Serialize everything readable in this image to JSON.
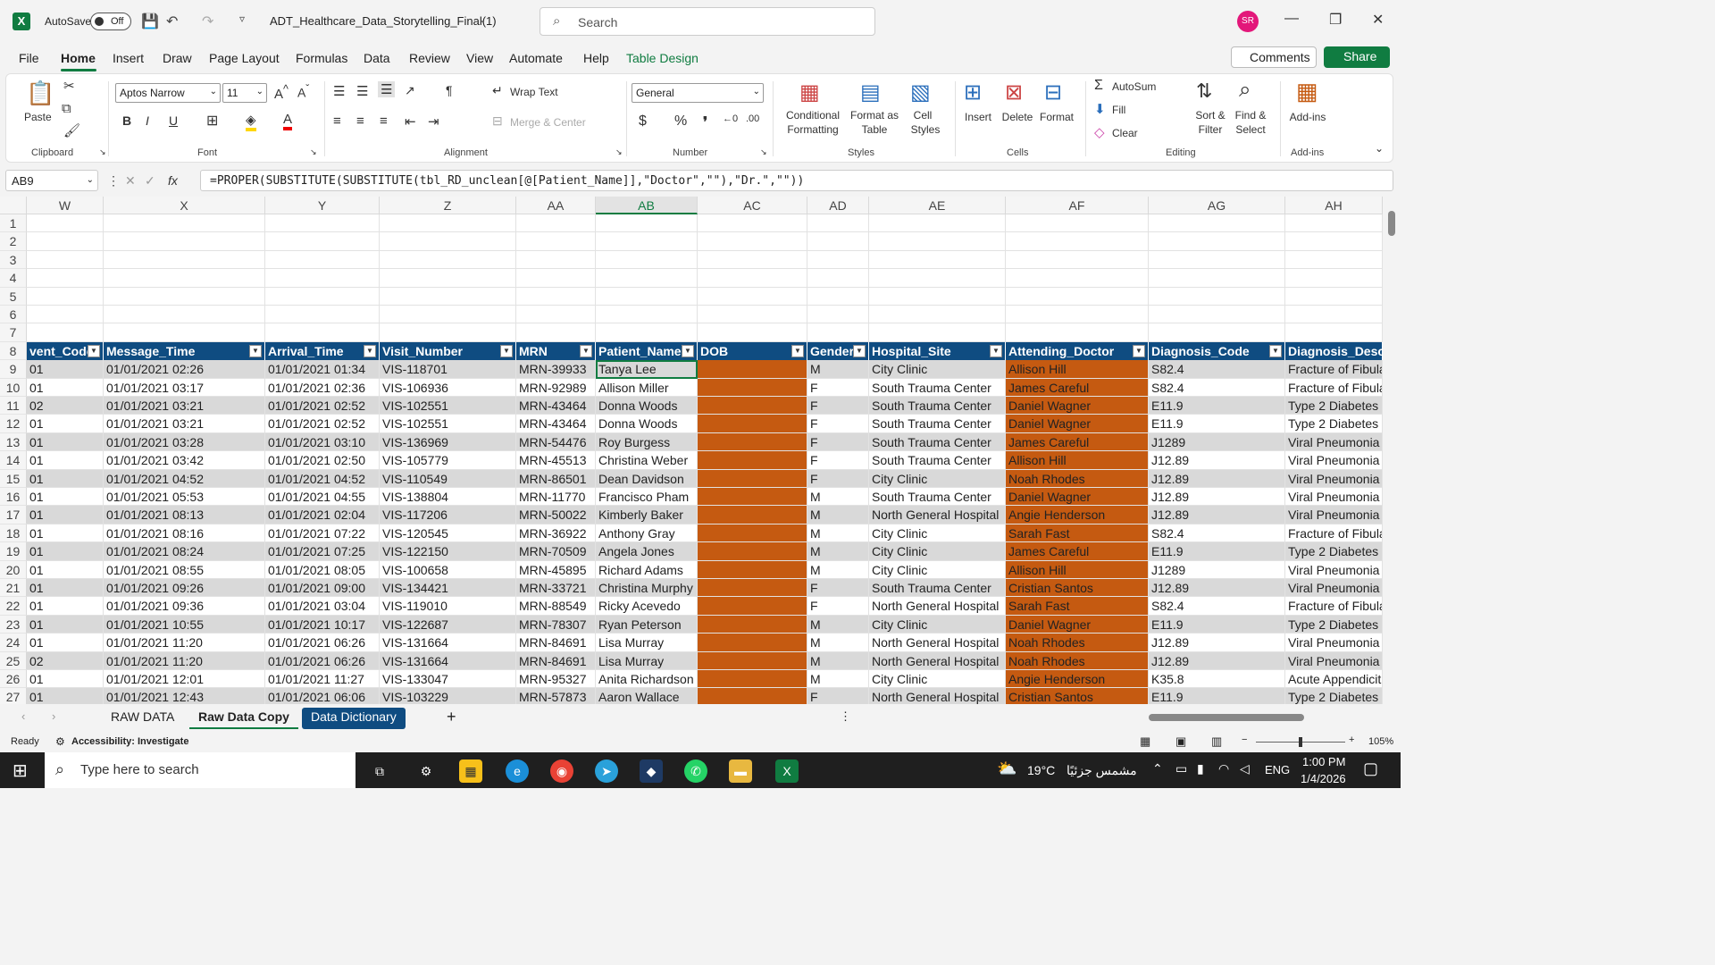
{
  "title_bar": {
    "autosave_label": "AutoSave",
    "autosave_state": "Off",
    "file_name": "ADT_Healthcare_Data_Storytelling_Final(1)",
    "search_placeholder": "Search",
    "avatar_initials": "SR"
  },
  "menu": [
    "File",
    "Home",
    "Insert",
    "Draw",
    "Page Layout",
    "Formulas",
    "Data",
    "Review",
    "View",
    "Automate",
    "Help",
    "Table Design"
  ],
  "header_buttons": {
    "comments": "Comments",
    "share": "Share"
  },
  "ribbon": {
    "clipboard": {
      "label": "Clipboard",
      "paste": "Paste"
    },
    "font": {
      "label": "Font",
      "name": "Aptos Narrow",
      "size": "11"
    },
    "alignment": {
      "label": "Alignment",
      "wrap": "Wrap Text",
      "merge": "Merge & Center"
    },
    "number": {
      "label": "Number",
      "format": "General"
    },
    "styles": {
      "label": "Styles",
      "cond1": "Conditional",
      "cond2": "Formatting",
      "fmt1": "Format as",
      "fmt2": "Table",
      "cell1": "Cell",
      "cell2": "Styles"
    },
    "cells": {
      "label": "Cells",
      "insert": "Insert",
      "delete": "Delete",
      "format": "Format"
    },
    "editing": {
      "label": "Editing",
      "autosum": "AutoSum",
      "fill": "Fill",
      "clear": "Clear",
      "sort1": "Sort &",
      "sort2": "Filter",
      "find1": "Find &",
      "find2": "Select"
    },
    "addins": {
      "label": "Add-ins",
      "btn": "Add-ins"
    }
  },
  "formula_bar": {
    "name_box": "AB9",
    "formula": "=PROPER(SUBSTITUTE(SUBSTITUTE(tbl_RD_unclean[@[Patient_Name]],\"Doctor\",\"\"),\"Dr.\",\"\"))"
  },
  "columns": [
    "W",
    "X",
    "Y",
    "Z",
    "AA",
    "AB",
    "AC",
    "AD",
    "AE",
    "AF",
    "AG",
    "AH"
  ],
  "selected_column": "AB",
  "row_numbers": [
    "1",
    "2",
    "3",
    "4",
    "5",
    "6",
    "7",
    "8",
    "9",
    "10",
    "11",
    "12",
    "13",
    "14",
    "15",
    "16",
    "17",
    "18",
    "19",
    "20",
    "21",
    "22",
    "23",
    "24",
    "25",
    "26",
    "27"
  ],
  "table_headers": [
    "vent_Code",
    "Message_Time",
    "Arrival_Time",
    "Visit_Number",
    "MRN",
    "Patient_Name",
    "DOB",
    "Gender",
    "Hospital_Site",
    "Attending_Doctor",
    "Diagnosis_Code",
    "Diagnosis_Desc"
  ],
  "rows": [
    [
      "01",
      "01/01/2021 02:26",
      "01/01/2021 01:34",
      "VIS-118701",
      "MRN-39933",
      "Tanya Lee",
      "",
      "M",
      "City Clinic",
      "Allison Hill",
      "S82.4",
      "Fracture of Fibula"
    ],
    [
      "01",
      "01/01/2021 03:17",
      "01/01/2021 02:36",
      "VIS-106936",
      "MRN-92989",
      "Allison Miller",
      "",
      "F",
      "South Trauma Center",
      "James Careful",
      "S82.4",
      "Fracture of Fibula"
    ],
    [
      "02",
      "01/01/2021 03:21",
      "01/01/2021 02:52",
      "VIS-102551",
      "MRN-43464",
      "Donna Woods",
      "",
      "F",
      "South Trauma Center",
      "Daniel Wagner",
      "E11.9",
      "Type 2 Diabetes"
    ],
    [
      "01",
      "01/01/2021 03:21",
      "01/01/2021 02:52",
      "VIS-102551",
      "MRN-43464",
      "Donna Woods",
      "",
      "F",
      "South Trauma Center",
      "Daniel Wagner",
      "E11.9",
      "Type 2 Diabetes"
    ],
    [
      "01",
      "01/01/2021 03:28",
      "01/01/2021 03:10",
      "VIS-136969",
      "MRN-54476",
      "Roy Burgess",
      "",
      "F",
      "South Trauma Center",
      "James Careful",
      "J1289",
      "Viral Pneumonia"
    ],
    [
      "01",
      "01/01/2021 03:42",
      "01/01/2021 02:50",
      "VIS-105779",
      "MRN-45513",
      "Christina Weber",
      "",
      "F",
      "South Trauma Center",
      "Allison Hill",
      "J12.89",
      "Viral Pneumonia"
    ],
    [
      "01",
      "01/01/2021 04:52",
      "01/01/2021 04:52",
      "VIS-110549",
      "MRN-86501",
      "Dean Davidson",
      "",
      "F",
      "City Clinic",
      "Noah Rhodes",
      "J12.89",
      "Viral Pneumonia"
    ],
    [
      "01",
      "01/01/2021 05:53",
      "01/01/2021 04:55",
      "VIS-138804",
      "MRN-11770",
      "Francisco Pham",
      "",
      "M",
      "South Trauma Center",
      "Daniel Wagner",
      "J12.89",
      "Viral Pneumonia"
    ],
    [
      "01",
      "01/01/2021 08:13",
      "01/01/2021 02:04",
      "VIS-117206",
      "MRN-50022",
      "Kimberly Baker",
      "",
      "M",
      "North General Hospital",
      "Angie Henderson",
      "J12.89",
      "Viral Pneumonia"
    ],
    [
      "01",
      "01/01/2021 08:16",
      "01/01/2021 07:22",
      "VIS-120545",
      "MRN-36922",
      "Anthony Gray",
      "",
      "M",
      "City Clinic",
      "Sarah Fast",
      "S82.4",
      "Fracture of Fibula"
    ],
    [
      "01",
      "01/01/2021 08:24",
      "01/01/2021 07:25",
      "VIS-122150",
      "MRN-70509",
      "Angela Jones",
      "",
      "M",
      "City Clinic",
      "James Careful",
      "E11.9",
      "Type 2 Diabetes"
    ],
    [
      "01",
      "01/01/2021 08:55",
      "01/01/2021 08:05",
      "VIS-100658",
      "MRN-45895",
      "Richard Adams",
      "",
      "M",
      "City Clinic",
      "Allison Hill",
      "J1289",
      "Viral Pneumonia"
    ],
    [
      "01",
      "01/01/2021 09:26",
      "01/01/2021 09:00",
      "VIS-134421",
      "MRN-33721",
      "Christina Murphy",
      "",
      "F",
      "South Trauma Center",
      "Cristian Santos",
      "J12.89",
      "Viral Pneumonia"
    ],
    [
      "01",
      "01/01/2021 09:36",
      "01/01/2021 03:04",
      "VIS-119010",
      "MRN-88549",
      "Ricky Acevedo",
      "",
      "F",
      "North General Hospital",
      "Sarah Fast",
      "S82.4",
      "Fracture of Fibula"
    ],
    [
      "01",
      "01/01/2021 10:55",
      "01/01/2021 10:17",
      "VIS-122687",
      "MRN-78307",
      "Ryan Peterson",
      "",
      "M",
      "City Clinic",
      "Daniel Wagner",
      "E11.9",
      "Type 2 Diabetes"
    ],
    [
      "01",
      "01/01/2021 11:20",
      "01/01/2021 06:26",
      "VIS-131664",
      "MRN-84691",
      "Lisa Murray",
      "",
      "M",
      "North General Hospital",
      "Noah Rhodes",
      "J12.89",
      "Viral Pneumonia"
    ],
    [
      "02",
      "01/01/2021 11:20",
      "01/01/2021 06:26",
      "VIS-131664",
      "MRN-84691",
      "Lisa Murray",
      "",
      "M",
      "North General Hospital",
      "Noah Rhodes",
      "J12.89",
      "Viral Pneumonia"
    ],
    [
      "01",
      "01/01/2021 12:01",
      "01/01/2021 11:27",
      "VIS-133047",
      "MRN-95327",
      "Anita Richardson",
      "",
      "M",
      "City Clinic",
      "Angie Henderson",
      "K35.8",
      "Acute Appendicitis"
    ],
    [
      "01",
      "01/01/2021 12:43",
      "01/01/2021 06:06",
      "VIS-103229",
      "MRN-57873",
      "Aaron Wallace",
      "",
      "F",
      "North General Hospital",
      "Cristian Santos",
      "E11.9",
      "Type 2 Diabetes"
    ]
  ],
  "sheets": [
    "RAW DATA",
    "Raw Data Copy",
    "Data Dictionary"
  ],
  "status": {
    "ready": "Ready",
    "accessibility": "Accessibility: Investigate",
    "zoom": "105%"
  },
  "taskbar": {
    "search_placeholder": "Type here to search",
    "weather": "19°C",
    "weather_text": "مشمس جزئيًا",
    "lang": "ENG",
    "time": "1:00 PM",
    "date": "1/4/2026"
  },
  "colors": {
    "table_header": "#0f4c81",
    "highlight": "#c55a11",
    "accent": "#107c41"
  }
}
